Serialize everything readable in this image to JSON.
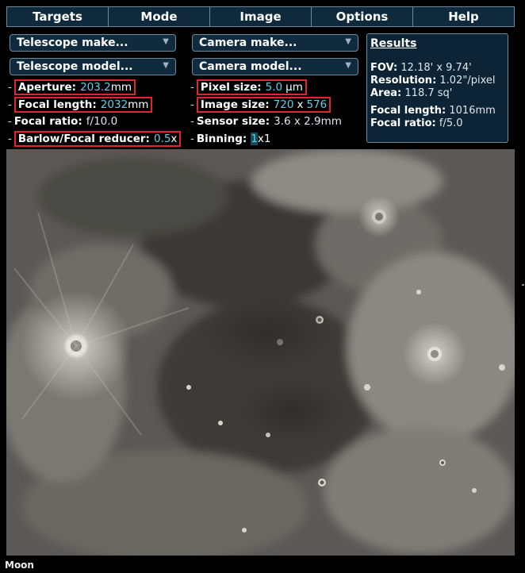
{
  "menu": [
    "Targets",
    "Mode",
    "Image",
    "Options",
    "Help"
  ],
  "telescope": {
    "make_label": "Telescope make...",
    "model_label": "Telescope model...",
    "aperture_label": "Aperture:",
    "aperture_value": "203.2",
    "aperture_unit": "mm",
    "focal_length_label": "Focal length:",
    "focal_length_value": "2032",
    "focal_length_unit": "mm",
    "focal_ratio_label": "Focal ratio:",
    "focal_ratio_value": "f/10.0",
    "barlow_label": "Barlow/Focal reducer:",
    "barlow_value": "0.5",
    "barlow_unit": "x"
  },
  "camera": {
    "make_label": "Camera make...",
    "model_label": "Camera model...",
    "pixel_size_label": "Pixel size:",
    "pixel_size_value": "5.0",
    "pixel_size_unit": "µm",
    "image_size_label": "Image size:",
    "image_size_w": "720",
    "image_size_x": "x",
    "image_size_h": "576",
    "sensor_size_label": "Sensor size:",
    "sensor_size_value": "3.6 x 2.9mm",
    "binning_label": "Binning:",
    "binning_value": "1",
    "binning_unit": "x1"
  },
  "results": {
    "title": "Results",
    "fov_label": "FOV:",
    "fov_value": "12.18' x 9.74'",
    "resolution_label": "Resolution:",
    "resolution_value": "1.02\"/pixel",
    "area_label": "Area:",
    "area_value": "118.7 sq'",
    "focal_length_label": "Focal length:",
    "focal_length_value": "1016mm",
    "focal_ratio_label": "Focal ratio:",
    "focal_ratio_value": "f/5.0"
  },
  "target_caption": "Moon",
  "dash": "-",
  "icons": {
    "dropdown": "chevron-down-icon"
  },
  "colors": {
    "accent_value": "#5fd0e6",
    "highlight_box": "#e1262b",
    "panel_bg": "#0f2b3d"
  }
}
